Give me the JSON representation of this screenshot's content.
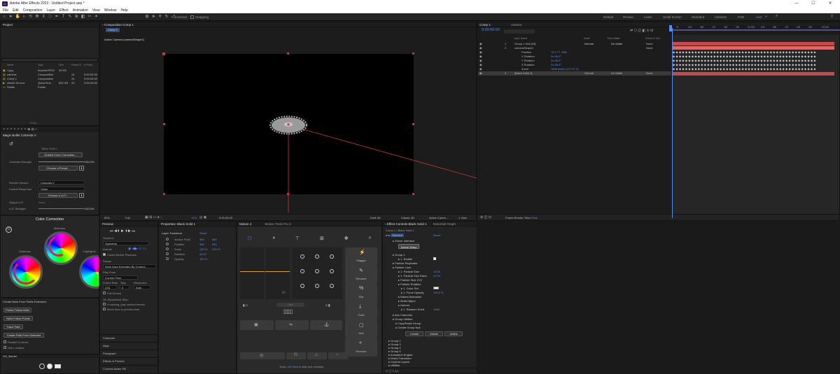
{
  "app": {
    "title": "Adobe After Effects 2023 - Untitled Project.aep *",
    "menu": [
      "File",
      "Edit",
      "Composition",
      "Layer",
      "Effect",
      "Animation",
      "View",
      "Window",
      "Help"
    ],
    "toolbar_labels": {
      "universal": "Universal",
      "snapping": "Snapping"
    },
    "workspaces": [
      "Default",
      "Review",
      "Learn",
      "Small Screen",
      "Standard",
      "Libraries",
      "FHD",
      "user"
    ]
  },
  "project": {
    "title": "Project",
    "columns": [
      "Name",
      "Type",
      "Size",
      "Frame R...",
      "In Point"
    ],
    "items": [
      {
        "name": "1.jpg",
        "type": "ImporteJPEG",
        "size": "40 KB",
        "fr": "",
        "in": ""
      },
      {
        "name": "camera",
        "type": "Composition",
        "size": "",
        "fr": "24",
        "in": "0:00:00:00"
      },
      {
        "name": "Comp 1",
        "type": "Composition",
        "size": "",
        "fr": "24",
        "in": "0:00:00:00"
      },
      {
        "name": "nbb02-30.mov",
        "type": "QuickTime",
        "size": "820 KB",
        "fr": "24",
        "in": "0:00:00:00"
      },
      {
        "name": "Solids",
        "type": "Folder",
        "size": "",
        "fr": "",
        "in": ""
      }
    ],
    "bpc": "8 bpc"
  },
  "colorista": {
    "title": "Magic Bullet Colorista V",
    "layer": "Black Solid 1",
    "guided_btn": "Guided Color Correction...",
    "strength_label": "Colorista Strength",
    "strength_value": "100.0%",
    "preset_btn": "Choose a Preset...",
    "version_label": "Render Version",
    "version_value": "Colorista V",
    "response_label": "Control Response",
    "response_value": "Video",
    "lut_btn": "Choose a LUT...",
    "output_label": "Output LUT",
    "output_value": "None",
    "lut_strength_label": "LUT Strength",
    "lut_strength_value": "100.0%",
    "cc_title": "Color Correction",
    "wheel_labels": [
      "Shadows",
      "Midtones",
      "Highlights"
    ]
  },
  "scripts": {
    "title": "Create Nulls From Paths Extended",
    "buttons": [
      "Points Follow Nulls",
      "Nulls Follow Points",
      "Trace Path",
      "Create Path From Selected"
    ],
    "checks": [
      "Parallel Controls",
      "Use Locators"
    ],
    "bumbl": "GG_Bumbl"
  },
  "composition": {
    "tab": "Composition Comp 1",
    "subtab": "Comp 1",
    "camera_label": "Active Camera (cameraShape1)",
    "zoom": "50%",
    "quality": "Full",
    "time": "0:00:00:00",
    "exposure": "+0.0",
    "renderer": "Draft 3D",
    "renderer2": "Classic 3D",
    "camera_dd": "Active Camer...",
    "view_dd": "1 View"
  },
  "timeline": {
    "tab1": "Comp 1",
    "tab2": "camera",
    "time": "0:00:00:00",
    "col_headers": {
      "name": "Layer Name",
      "mode": "Mode",
      "trkmat": "Track Matte",
      "parent": "Parent & Link"
    },
    "layers": [
      {
        "num": "1",
        "name": "Group 1 Null [16]",
        "mode": "",
        "matte": "",
        "parent": "None"
      },
      {
        "num": "2",
        "name": "cameraShape1",
        "mode": "",
        "matte": "",
        "parent": "None"
      },
      {
        "num": "",
        "name": "Position",
        "mode": "",
        "matte": "",
        "parent": ""
      },
      {
        "num": "",
        "name": "X Rotation",
        "mode": "",
        "matte": "",
        "parent": ""
      },
      {
        "num": "",
        "name": "Y Rotation",
        "mode": "",
        "matte": "",
        "parent": ""
      },
      {
        "num": "",
        "name": "Z Rotation",
        "mode": "",
        "matte": "",
        "parent": ""
      },
      {
        "num": "",
        "name": "Zoom",
        "mode": "",
        "matte": "",
        "parent": ""
      },
      {
        "num": "3",
        "name": "[Black Solid 1]",
        "mode": "Normal",
        "matte": "No Matte",
        "parent": "None"
      }
    ],
    "layer_values": [
      "",
      "",
      "78.7,77,-558",
      "0x-96.0°",
      "0x-96.0°",
      "0x-96.0°",
      "1866 pixels (107.8° H)",
      ""
    ],
    "layer1_mode": "Normal",
    "layer1_matte": "No Matte",
    "ruler": [
      "0f",
      "04f",
      "08f",
      "12f",
      "16f",
      "20f",
      "01:00f",
      "04f",
      "08f",
      "12f",
      "16f",
      "20f",
      "02:00f"
    ],
    "footer": "Frame Render Time",
    "footer_val": "13ms"
  },
  "preview": {
    "title": "Preview",
    "shortcut_label": "Shortcut",
    "shortcut_value": "Spacebar",
    "include_label": "Include",
    "cache_label": "Cache Before Playback",
    "range_label": "Range",
    "range_value": "Work Area Extended By Current...",
    "play_from_label": "Play From",
    "play_from_value": "Current Time",
    "framerate_label": "Frame Rate",
    "skip_label": "Skip",
    "resolution_label": "Resolution",
    "framerate": "(24)",
    "skip": "0",
    "resolution": "Auto",
    "fullscreen": "Full Screen",
    "spacebar_label": "On (Spacebar) Stop:",
    "if_caching": "If caching, play cached frames",
    "move_time": "Move time to preview time",
    "sections": [
      "Character",
      "Align",
      "Paragraph",
      "Effects & Presets",
      "Content-Aware Fill"
    ]
  },
  "properties": {
    "title": "Properties: Black Solid 1",
    "section": "Layer Transform",
    "reset": "Reset",
    "rows": [
      {
        "label": "Anchor Point",
        "v1": "960",
        "v2": "540"
      },
      {
        "label": "Position",
        "v1": "960",
        "v2": "540"
      },
      {
        "label": "Scale",
        "v1": "100 %",
        "v2": "100 %"
      },
      {
        "label": "Rotation",
        "v1": "0x+0°",
        "v2": ""
      },
      {
        "label": "Opacity",
        "v1": "100 %",
        "v2": ""
      }
    ]
  },
  "motion": {
    "tab1": "Motion 4",
    "tab2": "Motion Tools Pro 2",
    "side_buttons": [
      "Stagger",
      "Rename",
      "Flip",
      "Grab",
      "Null",
      "Reverse"
    ],
    "hint_prefix": "Tools:",
    "hint_link": "ctrl+click",
    "hint_suffix": "to skip tool overlays."
  },
  "effects": {
    "tab": "Effect Controls Black Solid 1",
    "tab2": "Essential Graph",
    "header": "Comp 1 • Black Solid 1",
    "effect_name": "Element",
    "reset": "Reset",
    "rows": [
      {
        "label": "Scene Interface",
        "value": ""
      },
      {
        "label": "Scene Setup",
        "value": ""
      },
      {
        "label": "Group 1",
        "value": ""
      },
      {
        "label": "1. Enable",
        "value": ""
      },
      {
        "label": "Particle Replicator",
        "value": ""
      },
      {
        "label": "Particle Look",
        "value": ""
      },
      {
        "label": "1. Particle Size",
        "value": "10.00"
      },
      {
        "label": "1. Particle Size Rand",
        "value": "0.0 %"
      },
      {
        "label": "Particle Size XYZ",
        "value": ""
      },
      {
        "label": "Particle Rotation",
        "value": ""
      },
      {
        "label": "1. Color Tint",
        "value": ""
      },
      {
        "label": "1. Force Opacity",
        "value": "100.0 %"
      },
      {
        "label": "Baked Animation",
        "value": ""
      },
      {
        "label": "Multi-Object",
        "value": ""
      },
      {
        "label": "Deform",
        "value": ""
      },
      {
        "label": "1. Random Seed",
        "value": "1000"
      },
      {
        "label": "Aux Channels",
        "value": ""
      },
      {
        "label": "Group Utilities",
        "value": ""
      },
      {
        "label": "Copy/Paste Group",
        "value": ""
      },
      {
        "label": "Create Group Null",
        "value": ""
      }
    ],
    "action_buttons": [
      "Create",
      "Delete",
      "Unlink"
    ],
    "groups": [
      "Group 2",
      "Group 3",
      "Group 4",
      "Group 5",
      "Animation Engine",
      "World Transform",
      "Custom Layers",
      "Utilities"
    ],
    "bpc": "8 bpc"
  },
  "colors": {
    "accent": "#4f8ff7",
    "layer_red": "#c64a4a",
    "layer_pink": "#d46a6a",
    "orange_line": "#e0a030"
  }
}
